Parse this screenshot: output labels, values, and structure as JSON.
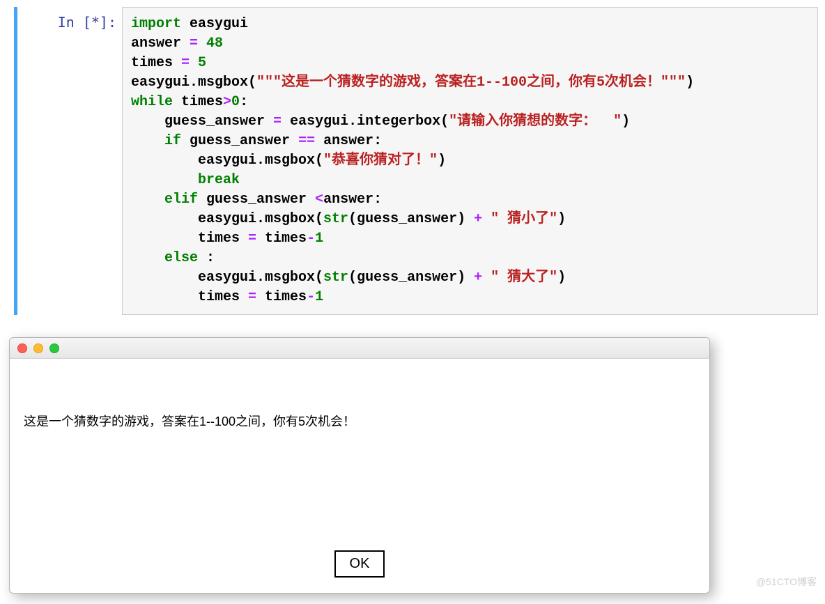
{
  "cell": {
    "prompt": "In [*]:",
    "code": {
      "l1a": "import",
      "l1b": " easygui",
      "l2a": "answer ",
      "l2op": "=",
      "l2b": " ",
      "l2n": "48",
      "l3a": "times ",
      "l3op": "=",
      "l3b": " ",
      "l3n": "5",
      "l4a": "easygui.msgbox(",
      "l4s": "\"\"\"这是一个猜数字的游戏，答案在1--100之间，你有5次机会！\"\"\"",
      "l4b": ")",
      "l5a": "while",
      "l5b": " times",
      "l5op": ">",
      "l5n": "0",
      "l5c": ":",
      "l6a": "    guess_answer ",
      "l6op": "=",
      "l6b": " easygui.integerbox(",
      "l6s": "\"请输入你猜想的数字：  \"",
      "l6c": ")",
      "l7a": "    ",
      "l7k": "if",
      "l7b": " guess_answer ",
      "l7op": "==",
      "l7c": " answer:",
      "l8a": "        easygui.msgbox(",
      "l8s": "\"恭喜你猜对了！\"",
      "l8b": ")",
      "l9a": "        ",
      "l9k": "break",
      "l10a": "    ",
      "l10k": "elif",
      "l10b": " guess_answer ",
      "l10op": "<",
      "l10c": "answer:",
      "l11a": "        easygui.msgbox(",
      "l11bi": "str",
      "l11b": "(guess_answer) ",
      "l11op": "+",
      "l11c": " ",
      "l11s": "\" 猜小了\"",
      "l11d": ")",
      "l12a": "        times ",
      "l12op": "=",
      "l12b": " times",
      "l12op2": "-",
      "l12n": "1",
      "l13a": "    ",
      "l13k": "else",
      "l13b": " :",
      "l14a": "        easygui.msgbox(",
      "l14bi": "str",
      "l14b": "(guess_answer) ",
      "l14op": "+",
      "l14c": " ",
      "l14s": "\" 猜大了\"",
      "l14d": ")",
      "l15a": "        times ",
      "l15op": "=",
      "l15b": " times",
      "l15op2": "-",
      "l15n": "1"
    }
  },
  "dialog": {
    "message": "这是一个猜数字的游戏，答案在1--100之间，你有5次机会！",
    "ok": "OK"
  },
  "watermark": "@51CTO博客"
}
